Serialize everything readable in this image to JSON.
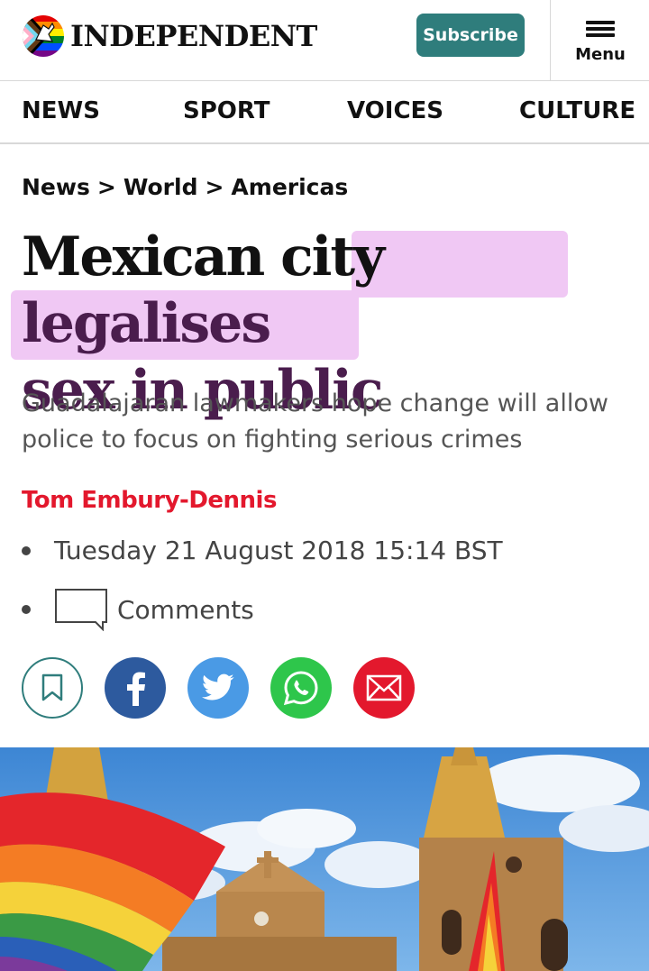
{
  "header": {
    "brand": "INDEPENDENT",
    "subscribe_label": "Subscribe",
    "menu_label": "Menu"
  },
  "nav": {
    "items": [
      "NEWS",
      "SPORT",
      "VOICES",
      "CULTURE"
    ]
  },
  "breadcrumb": [
    "News",
    "World",
    "Americas"
  ],
  "breadcrumb_separator": ">",
  "article": {
    "headline_plain": "Mexican city",
    "headline_highlight_1": "legalises",
    "headline_highlight_2": "sex in public",
    "standfirst": "Guadalajaran lawmakers hope change will allow police to focus on fighting serious crimes",
    "author": "Tom Embury-Dennis",
    "date": "Tuesday 21 August 2018 15:14 BST",
    "comments_label": "Comments"
  },
  "share": {
    "bookmark": "bookmark-icon",
    "facebook": "facebook-icon",
    "twitter": "twitter-icon",
    "whatsapp": "whatsapp-icon",
    "email": "email-icon"
  },
  "colors": {
    "subscribe_bg": "#2f7d7c",
    "author": "#e3182d",
    "highlight": "#f0c8f4",
    "highlight_text": "#4a1d4d",
    "facebook": "#2d5a9e",
    "twitter": "#4a9ae5",
    "whatsapp": "#2ec64b",
    "email": "#e3182d"
  }
}
